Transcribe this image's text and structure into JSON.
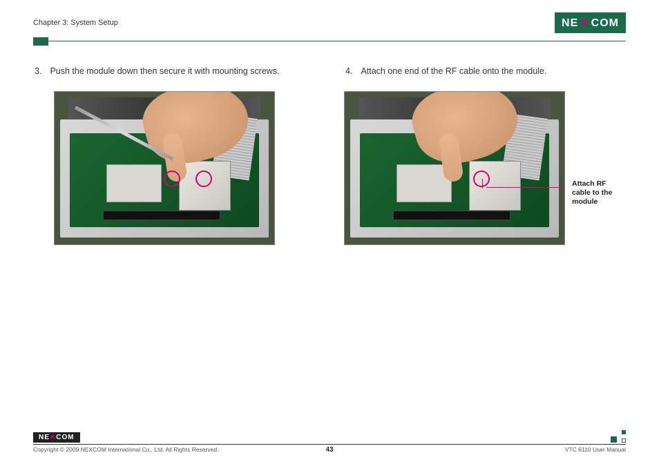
{
  "header": {
    "chapter": "Chapter 3: System Setup",
    "logo_text": "NE COM",
    "logo_x": "X"
  },
  "steps": {
    "left": {
      "num": "3.",
      "text": "Push the module down then secure it with mounting screws."
    },
    "right": {
      "num": "4.",
      "text": "Attach one end of the RF cable onto the module."
    }
  },
  "callout": {
    "text": "Attach RF cable to the module"
  },
  "footer": {
    "logo": "NEXCOM",
    "copyright": "Copyright © 2009 NEXCOM International Co., Ltd. All Rights Reserved.",
    "page": "43",
    "manual": "VTC 6110 User Manual"
  }
}
